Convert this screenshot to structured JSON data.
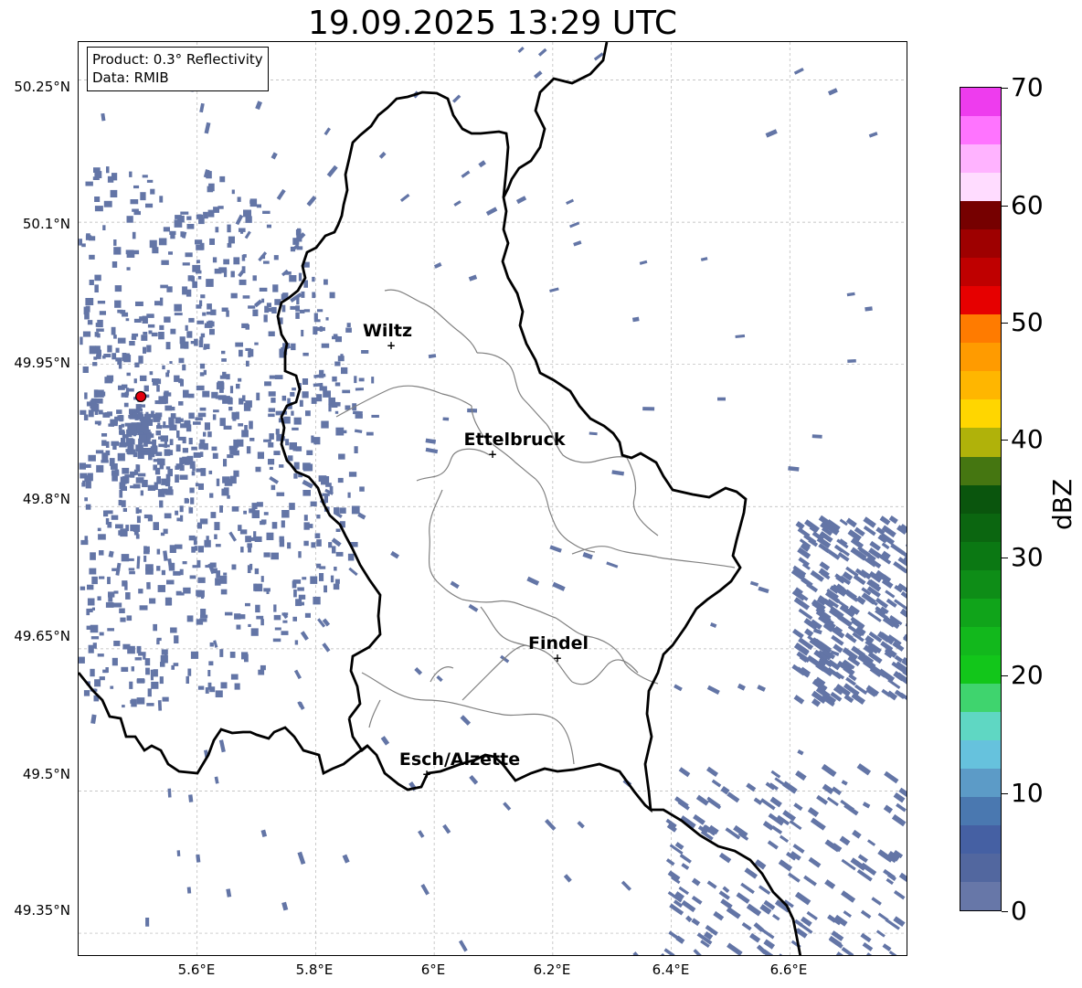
{
  "title": "19.09.2025 13:29 UTC",
  "info_box": {
    "product": "Product: 0.3° Reflectivity",
    "data_source": "Data: RMIB"
  },
  "lat_ticks": [
    "50.25°N",
    "50.1°N",
    "49.95°N",
    "49.8°N",
    "49.65°N",
    "49.5°N",
    "49.35°N"
  ],
  "lon_ticks": [
    "5.6°E",
    "5.8°E",
    "6°E",
    "6.2°E",
    "6.4°E",
    "6.6°E"
  ],
  "cities": [
    {
      "name": "Wiltz",
      "lat": 49.966,
      "lon": 5.93
    },
    {
      "name": "Ettelbruck",
      "lat": 49.847,
      "lon": 6.1
    },
    {
      "name": "Findel",
      "lat": 49.627,
      "lon": 6.21
    },
    {
      "name": "Esch/Alzette",
      "lat": 49.5,
      "lon": 5.99
    }
  ],
  "radar_site": {
    "lat": 49.916,
    "lon": 5.505,
    "color": "#e3000f"
  },
  "echo_color": "#6375a6",
  "colorbar": {
    "label": "dBZ",
    "ticks": [
      "0",
      "10",
      "20",
      "30",
      "40",
      "50",
      "60",
      "70"
    ],
    "colors": [
      "#6777a8",
      "#52679f",
      "#4560a3",
      "#4a78b0",
      "#5c9bc7",
      "#66c2dd",
      "#5fd7c3",
      "#3fd46e",
      "#12c61a",
      "#12b81c",
      "#10a41a",
      "#0e8d17",
      "#0b7813",
      "#0b6610",
      "#0a550d",
      "#457611",
      "#b0b20a",
      "#ffd600",
      "#ffb600",
      "#ff9b00",
      "#ff7b00",
      "#e60000",
      "#bf0000",
      "#9e0000",
      "#760000",
      "#ffdcff",
      "#ffb3ff",
      "#ff74ff",
      "#ee3cee"
    ]
  }
}
